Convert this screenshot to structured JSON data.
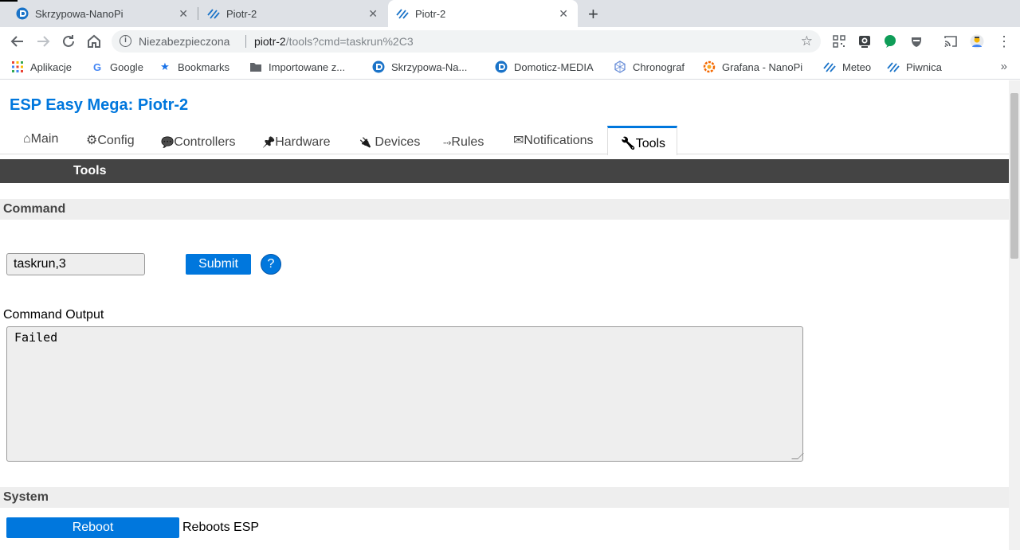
{
  "browser": {
    "tabs": [
      {
        "title": "Skrzypowa-NanoPi",
        "icon": "domoticz-icon",
        "active": false
      },
      {
        "title": "Piotr-2",
        "icon": "esp-easy-icon",
        "active": false
      },
      {
        "title": "Piotr-2",
        "icon": "esp-easy-icon",
        "active": true
      }
    ],
    "address": {
      "security_label": "Niezabezpieczona",
      "host": "piotr-2",
      "path": "/tools?cmd=taskrun%2C3"
    },
    "bookmarks": [
      {
        "label": "Aplikacje",
        "icon": "apps-grid-icon"
      },
      {
        "label": "Google",
        "icon": "google-icon"
      },
      {
        "label": "Bookmarks",
        "icon": "star-icon"
      },
      {
        "label": "Importowane z...",
        "icon": "folder-icon"
      },
      {
        "label": "Skrzypowa-Na...",
        "icon": "domoticz-icon"
      },
      {
        "label": "Domoticz-MEDIA",
        "icon": "domoticz-icon"
      },
      {
        "label": "Chronograf",
        "icon": "chronograf-icon"
      },
      {
        "label": "Grafana - NanoPi",
        "icon": "grafana-icon"
      },
      {
        "label": "Meteo",
        "icon": "esp-easy-icon"
      },
      {
        "label": "Piwnica",
        "icon": "esp-easy-icon"
      }
    ]
  },
  "page": {
    "title": "ESP Easy Mega: Piotr-2",
    "menu": [
      {
        "icon": "⌂",
        "label": "Main"
      },
      {
        "icon": "⚙",
        "label": "Config"
      },
      {
        "icon": "💬",
        "label": "Controllers"
      },
      {
        "icon": "📌",
        "label": "Hardware"
      },
      {
        "icon": "🔌",
        "label": "Devices"
      },
      {
        "icon": "⤑",
        "label": "Rules"
      },
      {
        "icon": "✉",
        "label": "Notifications"
      },
      {
        "icon": "🔧",
        "label": "Tools"
      }
    ],
    "header_bar": "Tools",
    "command_section": "Command",
    "command_value": "taskrun,3",
    "submit_label": "Submit",
    "help_label": "?",
    "output_label": "Command Output",
    "output_text": "Failed",
    "system_section": "System",
    "reboot_label": "Reboot",
    "reboot_desc": "Reboots ESP"
  },
  "colors": {
    "accent": "#0077dd",
    "header_bar": "#444444",
    "section_bg": "#eeeeee"
  }
}
